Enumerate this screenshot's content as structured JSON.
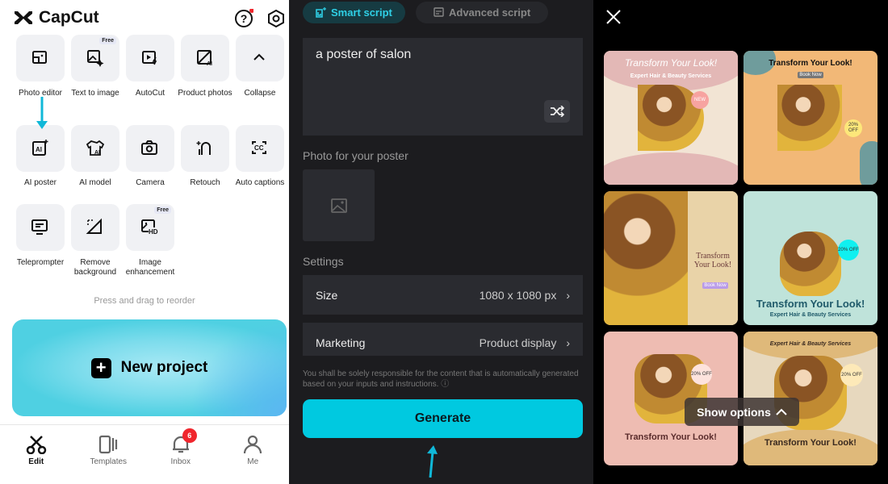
{
  "app": {
    "name": "CapCut"
  },
  "tools": [
    {
      "label": "Photo editor",
      "icon": "photo-editor-icon"
    },
    {
      "label": "Text to image",
      "icon": "text-to-image-icon",
      "badge": "Free"
    },
    {
      "label": "AutoCut",
      "icon": "autocut-icon"
    },
    {
      "label": "Product photos",
      "icon": "product-photos-icon"
    },
    {
      "label": "Collapse",
      "icon": "chevron-up-icon"
    },
    {
      "label": "AI poster",
      "icon": "ai-poster-icon"
    },
    {
      "label": "AI model",
      "icon": "ai-model-icon"
    },
    {
      "label": "Camera",
      "icon": "camera-icon"
    },
    {
      "label": "Retouch",
      "icon": "retouch-icon"
    },
    {
      "label": "Auto captions",
      "icon": "captions-icon"
    },
    {
      "label": "Teleprompter",
      "icon": "teleprompter-icon"
    },
    {
      "label": "Remove background",
      "icon": "remove-background-icon"
    },
    {
      "label": "Image enhancement",
      "icon": "image-enhancement-icon",
      "badge": "Free"
    }
  ],
  "hint": "Press and drag to reorder",
  "new_project": "New project",
  "nav": [
    {
      "label": "Edit"
    },
    {
      "label": "Templates"
    },
    {
      "label": "Inbox",
      "badge": "6"
    },
    {
      "label": "Me"
    }
  ],
  "poster_form": {
    "tabs": [
      {
        "label": "Smart script",
        "active": true
      },
      {
        "label": "Advanced script"
      }
    ],
    "prompt": "a poster of salon",
    "photo_label": "Photo for your poster",
    "settings_label": "Settings",
    "size": {
      "label": "Size",
      "value": "1080 x 1080 px"
    },
    "marketing": {
      "label": "Marketing",
      "value": "Product display"
    },
    "disclaimer": "You shall be solely responsible for the content that is automatically generated based on your inputs and instructions.",
    "generate": "Generate"
  },
  "results": {
    "show_options": "Show options",
    "posters": [
      {
        "title": "Transform Your Look!",
        "sub": "Expert Hair & Beauty Services",
        "badge": "NEW",
        "bg": "#f2e4d4",
        "accent": "#e3b8b6"
      },
      {
        "title": "Transform Your Look!",
        "sub": "Book Now",
        "badge": "20% OFF",
        "bg": "#f2b877",
        "accent": "#6f9c9c"
      },
      {
        "title": "Transform Your Look!",
        "sub": "Book Now",
        "badge": "",
        "bg": "#e8cf9a",
        "accent": "#b67fd6"
      },
      {
        "title": "Transform Your Look!",
        "sub": "Expert Hair & Beauty Services",
        "badge": "20% OFF",
        "bg": "#bfe3da",
        "accent": "#10f0f0"
      },
      {
        "title": "Transform Your Look!",
        "sub": "",
        "badge": "20% OFF",
        "bg": "#eebcb2",
        "accent": "#fde3dd"
      },
      {
        "title": "Transform Your Look!",
        "sub": "Expert Hair & Beauty Services",
        "badge": "20% OFF",
        "bg": "#e7d8be",
        "accent": "#dfb97a"
      }
    ]
  },
  "colors": {
    "accent": "#00c9e0",
    "badge": "#f0262d"
  }
}
